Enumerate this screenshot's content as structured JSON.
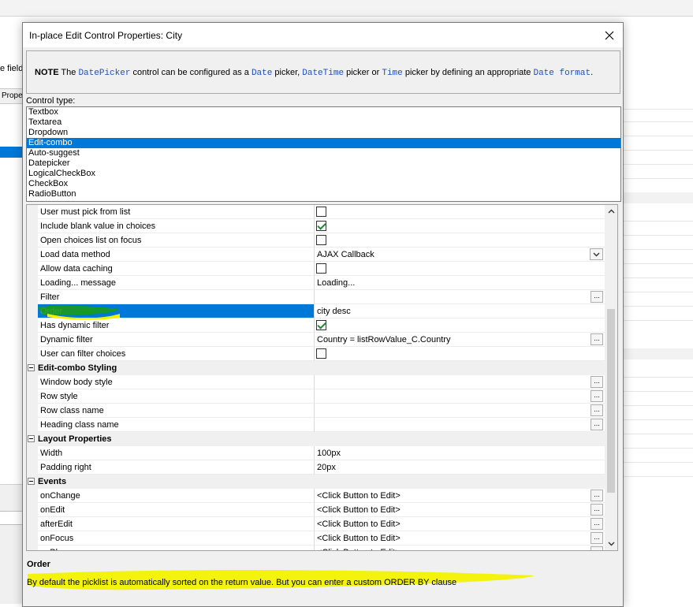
{
  "background": {
    "fields_text": "e fields",
    "tab_text": "Prope"
  },
  "dialog": {
    "title": "In-place Edit Control Properties: City",
    "note": {
      "bold": "NOTE",
      "t1": " The ",
      "c1": "DatePicker",
      "t2": " control can be configured as a ",
      "c2": "Date",
      "t3": " picker, ",
      "c3": "DateTime",
      "t4": " picker or ",
      "c4": "Time",
      "t5": " picker by defining an appropriate ",
      "c5": "Date format",
      "t6": "."
    },
    "control_type_label": "Control type:",
    "control_types": [
      "Textbox",
      "Textarea",
      "Dropdown",
      "Edit-combo",
      "Auto-suggest",
      "Datepicker",
      "LogicalCheckBox",
      "CheckBox",
      "RadioButton"
    ],
    "selected_control_type": "Edit-combo",
    "properties": [
      {
        "kind": "prop",
        "name": "User must pick from list",
        "type": "check",
        "checked": false
      },
      {
        "kind": "prop",
        "name": "Include blank value in choices",
        "type": "check",
        "checked": true
      },
      {
        "kind": "prop",
        "name": "Open choices list on focus",
        "type": "check",
        "checked": false
      },
      {
        "kind": "prop",
        "name": "Load data method",
        "type": "dropdown",
        "value": "AJAX Callback"
      },
      {
        "kind": "prop",
        "name": "Allow data caching",
        "type": "check",
        "checked": false
      },
      {
        "kind": "prop",
        "name": "Loading... message",
        "type": "text",
        "value": "Loading..."
      },
      {
        "kind": "prop",
        "name": "Filter",
        "type": "ellipsis",
        "value": ""
      },
      {
        "kind": "prop",
        "name": "Order",
        "type": "text",
        "value": "city desc",
        "selected": true
      },
      {
        "kind": "prop",
        "name": "Has dynamic filter",
        "type": "check",
        "checked": true
      },
      {
        "kind": "prop",
        "name": "Dynamic filter",
        "type": "ellipsis",
        "value": "Country = listRowValue_C.Country"
      },
      {
        "kind": "prop",
        "name": "User can filter choices",
        "type": "check",
        "checked": false
      },
      {
        "kind": "category",
        "name": "Edit-combo Styling"
      },
      {
        "kind": "prop",
        "name": "Window body style",
        "type": "ellipsis",
        "value": ""
      },
      {
        "kind": "prop",
        "name": "Row style",
        "type": "ellipsis",
        "value": ""
      },
      {
        "kind": "prop",
        "name": "Row class name",
        "type": "ellipsis",
        "value": ""
      },
      {
        "kind": "prop",
        "name": "Heading class name",
        "type": "ellipsis",
        "value": ""
      },
      {
        "kind": "category",
        "name": "Layout Properties"
      },
      {
        "kind": "prop",
        "name": "Width",
        "type": "text",
        "value": "100px"
      },
      {
        "kind": "prop",
        "name": "Padding right",
        "type": "text",
        "value": "20px"
      },
      {
        "kind": "category",
        "name": "Events"
      },
      {
        "kind": "prop",
        "name": "onChange",
        "type": "ellipsis",
        "value": "<Click Button to Edit>"
      },
      {
        "kind": "prop",
        "name": "onEdit",
        "type": "ellipsis",
        "value": "<Click Button to Edit>"
      },
      {
        "kind": "prop",
        "name": "afterEdit",
        "type": "ellipsis",
        "value": "<Click Button to Edit>"
      },
      {
        "kind": "prop",
        "name": "onFocus",
        "type": "ellipsis",
        "value": "<Click Button to Edit>"
      },
      {
        "kind": "prop",
        "name": "onBlur",
        "type": "ellipsis",
        "value": "<Click Button to Edit>"
      }
    ],
    "description": {
      "title": "Order",
      "text": "By default the picklist is automatically sorted on the return value. But you can enter a custom ORDER BY clause"
    },
    "colors": {
      "selection": "#0078d7",
      "highlighter_green": "#1a9a1a",
      "highlighter_yellow": "#f2f200",
      "code_text": "#1f4fb8"
    }
  }
}
